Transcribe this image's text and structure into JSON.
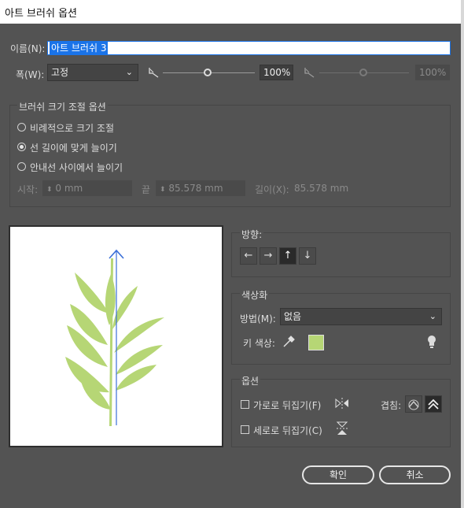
{
  "window": {
    "title": "아트 브러쉬 옵션"
  },
  "name": {
    "label": "이름(N):",
    "value": "아트 브러쉬 3"
  },
  "width": {
    "label": "폭(W):",
    "mode": "고정",
    "value": "100%",
    "value2": "100%"
  },
  "scale_group": {
    "title": "브러쉬 크기 조절 옵션",
    "options": [
      "비례적으로 크기 조절",
      "선 길이에 맞게 늘이기",
      "안내선 사이에서 늘이기"
    ],
    "selected_index": 1,
    "start_label": "시작:",
    "start_value": "0 mm",
    "end_label": "끝",
    "end_value": "85.578 mm",
    "length_label": "길이(X):",
    "length_value": "85.578 mm"
  },
  "direction": {
    "title": "방향:",
    "buttons": [
      "←",
      "→",
      "↑",
      "↓"
    ],
    "selected_index": 2
  },
  "colorize": {
    "title": "색상화",
    "method_label": "방법(M):",
    "method_value": "없음",
    "key_label": "키 색상:",
    "key_color": "#b6d675"
  },
  "options": {
    "title": "옵션",
    "flip_h": "가로로 뒤집기(F)",
    "flip_v": "세로로 뒤집기(C)",
    "overlap_label": "겹침:"
  },
  "buttons": {
    "ok": "확인",
    "cancel": "취소"
  },
  "colors": {
    "accent": "#1a73e8",
    "leaf": "#b6d675",
    "arrow": "#3a6fd8"
  }
}
